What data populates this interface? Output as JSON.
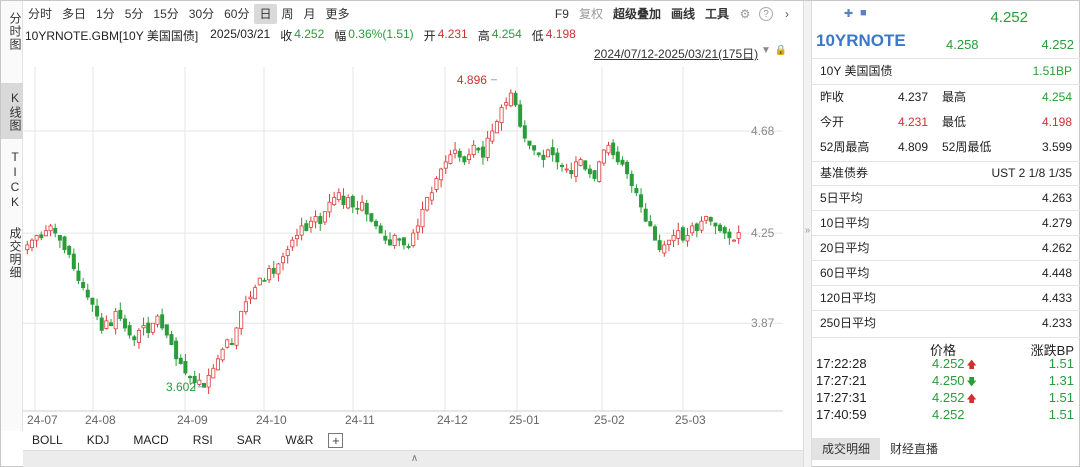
{
  "left_tabs": [
    "分时图",
    "K线图",
    "TICK",
    "成交明细"
  ],
  "toolbar": {
    "periods": [
      "分时",
      "多日",
      "1分",
      "5分",
      "15分",
      "30分",
      "60分",
      "日",
      "周",
      "月",
      "更多"
    ],
    "active_period": "日",
    "right": {
      "f9": "F9",
      "restore": "复权",
      "overlay": "超级叠加",
      "draw": "画线",
      "tools": "工具"
    }
  },
  "info": {
    "symbol": "10YRNOTE.GBM[10Y 美国国债]",
    "date": "2025/03/21",
    "close_label": "收",
    "close": "4.252",
    "change_label": "幅",
    "change": "0.36%(1.51)",
    "open_label": "开",
    "open": "4.231",
    "high_label": "高",
    "high": "4.254",
    "low_label": "低",
    "low": "4.198"
  },
  "range_text": "2024/07/12-2025/03/21(175日)",
  "indicators": [
    "BOLL",
    "KDJ",
    "MACD",
    "RSI",
    "SAR",
    "W&R"
  ],
  "chart_data": {
    "type": "candlestick",
    "x_labels": [
      "24-07",
      "24-08",
      "24-09",
      "24-10",
      "24-11",
      "24-12",
      "25-01",
      "25-02",
      "25-03"
    ],
    "y_ticks": [
      3.87,
      4.25,
      4.68
    ],
    "ylim": [
      3.5,
      4.95
    ],
    "annotations": [
      {
        "label": "4.896",
        "value": 4.896,
        "date": "2025-01-14"
      },
      {
        "label": "3.602",
        "value": 3.602,
        "date": "2024-09-16"
      }
    ],
    "colors": {
      "up": "#e03a3a",
      "down": "#2a9c3a",
      "grid": "#e6e6e6",
      "axis_text": "#888888"
    },
    "closes": [
      4.2,
      4.22,
      4.24,
      4.23,
      4.26,
      4.28,
      4.25,
      4.22,
      4.18,
      4.16,
      4.1,
      4.05,
      4.02,
      3.98,
      3.95,
      3.9,
      3.84,
      3.88,
      3.86,
      3.92,
      3.89,
      3.85,
      3.82,
      3.8,
      3.84,
      3.86,
      3.83,
      3.87,
      3.9,
      3.85,
      3.82,
      3.78,
      3.72,
      3.7,
      3.66,
      3.64,
      3.62,
      3.63,
      3.6,
      3.65,
      3.68,
      3.72,
      3.76,
      3.8,
      3.78,
      3.85,
      3.92,
      3.96,
      3.98,
      4.02,
      4.06,
      4.05,
      4.1,
      4.08,
      4.12,
      4.15,
      4.18,
      4.22,
      4.24,
      4.28,
      4.26,
      4.3,
      4.32,
      4.29,
      4.34,
      4.38,
      4.4,
      4.42,
      4.37,
      4.4,
      4.36,
      4.35,
      4.38,
      4.33,
      4.3,
      4.28,
      4.25,
      4.22,
      4.2,
      4.24,
      4.22,
      4.2,
      4.19,
      4.25,
      4.28,
      4.35,
      4.4,
      4.42,
      4.48,
      4.52,
      4.55,
      4.58,
      4.6,
      4.57,
      4.55,
      4.58,
      4.62,
      4.6,
      4.57,
      4.65,
      4.68,
      4.72,
      4.78,
      4.8,
      4.84,
      4.79,
      4.7,
      4.65,
      4.62,
      4.6,
      4.58,
      4.56,
      4.6,
      4.58,
      4.55,
      4.53,
      4.52,
      4.5,
      4.55,
      4.56,
      4.52,
      4.5,
      4.48,
      4.55,
      4.6,
      4.62,
      4.58,
      4.55,
      4.54,
      4.5,
      4.45,
      4.42,
      4.36,
      4.3,
      4.28,
      4.22,
      4.18,
      4.2,
      4.22,
      4.24,
      4.26,
      4.22,
      4.24,
      4.28,
      4.26,
      4.3,
      4.32,
      4.3,
      4.28,
      4.26,
      4.25,
      4.23,
      4.22,
      4.252
    ]
  },
  "panel": {
    "header_price": "4.252",
    "name": "10YRNOTE",
    "quote1": "4.258",
    "quote2": "4.252",
    "sub_name": "10Y 美国国债",
    "sub_change": "1.51BP",
    "rows": [
      {
        "l1": "昨收",
        "v1": "4.237",
        "c1": "n",
        "l2": "最高",
        "v2": "4.254",
        "c2": "g"
      },
      {
        "l1": "今开",
        "v1": "4.231",
        "c1": "r",
        "l2": "最低",
        "v2": "4.198",
        "c2": "r"
      },
      {
        "l1": "52周最高",
        "v1": "4.809",
        "c1": "n",
        "l2": "52周最低",
        "v2": "3.599",
        "c2": "n"
      }
    ],
    "bench_label": "基准债券",
    "bench_value": "UST 2 1/8 1/35",
    "averages": [
      {
        "label": "5日平均",
        "value": "4.263"
      },
      {
        "label": "10日平均",
        "value": "4.279"
      },
      {
        "label": "20日平均",
        "value": "4.262"
      },
      {
        "label": "60日平均",
        "value": "4.448"
      },
      {
        "label": "120日平均",
        "value": "4.433"
      },
      {
        "label": "250日平均",
        "value": "4.233"
      }
    ],
    "tick_headers": {
      "price": "价格",
      "change": "涨跌BP"
    },
    "ticks": [
      {
        "time": "17:22:28",
        "price": "4.252",
        "dir": "up",
        "bp": "1.51"
      },
      {
        "time": "17:27:21",
        "price": "4.250",
        "dir": "down",
        "bp": "1.31"
      },
      {
        "time": "17:27:31",
        "price": "4.252",
        "dir": "up",
        "bp": "1.51"
      },
      {
        "time": "17:40:59",
        "price": "4.252",
        "dir": "",
        "bp": "1.51"
      }
    ],
    "bottom_tabs": [
      "成交明细",
      "财经直播"
    ],
    "active_bottom_tab": "成交明细"
  }
}
